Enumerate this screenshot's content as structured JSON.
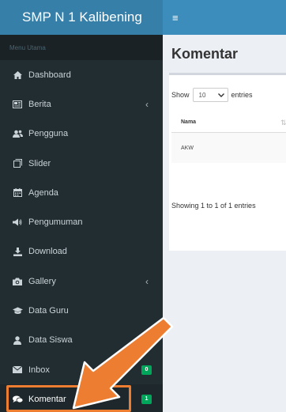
{
  "app": {
    "title": "SMP N 1 Kalibening"
  },
  "sidebar": {
    "header": "Menu Utama",
    "items": [
      {
        "label": "Dashboard",
        "icon": "home-icon"
      },
      {
        "label": "Berita",
        "icon": "newspaper-icon",
        "has_submenu": true
      },
      {
        "label": "Pengguna",
        "icon": "users-icon"
      },
      {
        "label": "Slider",
        "icon": "slider-icon"
      },
      {
        "label": "Agenda",
        "icon": "calendar-icon"
      },
      {
        "label": "Pengumuman",
        "icon": "megaphone-icon"
      },
      {
        "label": "Download",
        "icon": "download-icon"
      },
      {
        "label": "Gallery",
        "icon": "camera-icon",
        "has_submenu": true
      },
      {
        "label": "Data Guru",
        "icon": "graduation-cap-icon"
      },
      {
        "label": "Data Siswa",
        "icon": "user-icon"
      },
      {
        "label": "Inbox",
        "icon": "envelope-icon",
        "badge": "0"
      },
      {
        "label": "Komentar",
        "icon": "comments-icon",
        "badge": "1",
        "active": true
      }
    ]
  },
  "topbar": {
    "menu_toggle": "≡"
  },
  "main": {
    "title": "Komentar",
    "length_menu": {
      "prefix": "Show",
      "value": "10",
      "suffix": "entries"
    },
    "table": {
      "columns": [
        "Nama"
      ],
      "rows": [
        [
          "AKW"
        ]
      ]
    },
    "info": "Showing 1 to 1 of 1 entries"
  },
  "colors": {
    "sidebar_bg": "#222d32",
    "logo_bg": "#367fa9",
    "topbar_bg": "#3c8dbc",
    "badge_green": "#00a65a",
    "annotation_orange": "#ed7d31"
  }
}
